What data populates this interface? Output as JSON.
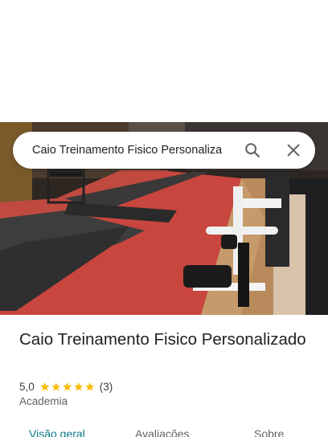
{
  "search": {
    "value": "Caio Treinamento Fisico Personaliza"
  },
  "place": {
    "title": "Caio Treinamento Fisico Personalizado",
    "rating": "5,0",
    "stars": 5,
    "review_count": "(3)",
    "category": "Academia"
  },
  "tabs": [
    {
      "label": "Visão geral",
      "active": true
    },
    {
      "label": "Avaliações",
      "active": false
    },
    {
      "label": "Sobre",
      "active": false
    }
  ],
  "colors": {
    "star": "#fbbc04",
    "active_tab": "#0b7a8a",
    "text_primary": "#202124"
  }
}
